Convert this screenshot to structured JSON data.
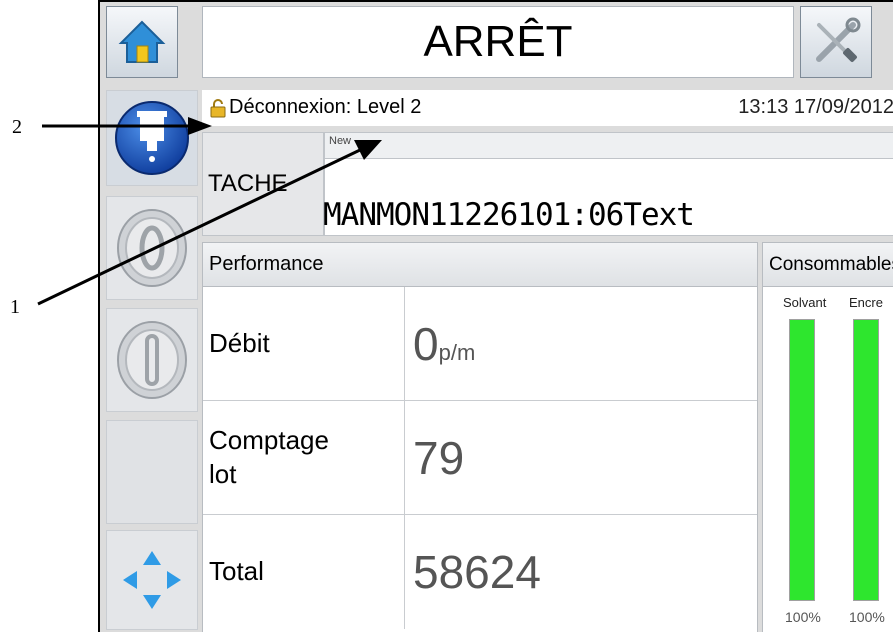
{
  "header": {
    "title": "ARRÊT"
  },
  "status": {
    "login": "Déconnexion: Level 2",
    "datetime": "13:13 17/09/2012"
  },
  "job": {
    "label": "TACHE",
    "name": "New",
    "message": "MANMON11226101:06Text"
  },
  "performance": {
    "title": "Performance",
    "rows": [
      {
        "label": "Débit",
        "value": "0",
        "unit": "p/m"
      },
      {
        "label": "Comptage\nlot",
        "value": "79",
        "unit": ""
      },
      {
        "label": "Total",
        "value": "58624",
        "unit": ""
      }
    ]
  },
  "consumables": {
    "title": "Consommables",
    "gauges": [
      {
        "label": "Solvant",
        "percent_text": "100%",
        "level": 1.0
      },
      {
        "label": "Encre",
        "percent_text": "100%",
        "level": 1.0
      }
    ]
  },
  "callouts": {
    "one": "1",
    "two": "2"
  },
  "colors": {
    "gauge_green": "#2ee62e",
    "status_blue": "#1f56b8"
  }
}
